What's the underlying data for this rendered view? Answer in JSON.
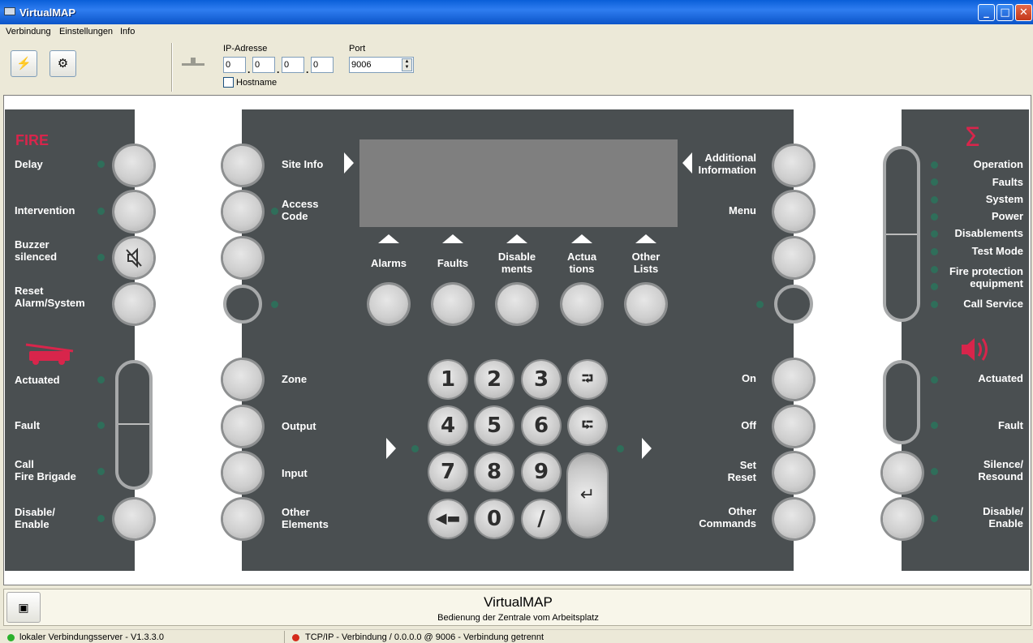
{
  "window": {
    "title": "VirtualMAP",
    "minimize": "_",
    "maximize": "□",
    "close": "✕"
  },
  "menu": [
    "Verbindung",
    "Einstellungen",
    "Info"
  ],
  "toolbar": {
    "connect_icon": "⚡",
    "settings_icon": "⚙",
    "ip_label": "IP-Adresse",
    "ip": [
      "0",
      "0",
      "0",
      "0"
    ],
    "ip_separator": ".",
    "port_label": "Port",
    "port": "9006",
    "hostname_label": "Hostname",
    "hostname_checked": false
  },
  "panel": {
    "left": {
      "fire_title": "FIRE",
      "buttons": [
        "Delay",
        "Intervention",
        "Buzzer\nsilenced",
        "Reset\nAlarm/System"
      ],
      "brigade_buttons": [
        "Actuated",
        "Fault",
        "Call\nFire Brigade",
        "Disable/\nEnable"
      ]
    },
    "center_left": [
      "Site Info",
      "Access\nCode",
      "Zone",
      "Output",
      "Input",
      "Other\nElements"
    ],
    "center_right": [
      "Additional\nInformation",
      "Menu",
      "On",
      "Off",
      "Set\nReset",
      "Other\nCommands"
    ],
    "softkeys": [
      "Alarms",
      "Faults",
      "Disable\nments",
      "Actua\ntions",
      "Other\nLists"
    ],
    "numpad": [
      "1",
      "2",
      "3",
      "4",
      "5",
      "6",
      "7",
      "8",
      "9",
      "◀▬",
      "0",
      "/"
    ],
    "numpad_nav": [
      "⮒",
      "⮓"
    ],
    "enter": "↵",
    "right": {
      "sigma": "Σ",
      "indicators": [
        "Operation",
        "Faults",
        "System",
        "Power",
        "Disablements",
        "Test Mode",
        "Fire protection\nequipment",
        "Call Service"
      ],
      "alarm_buttons": [
        "Actuated",
        "Fault",
        "Silence/\nResound",
        "Disable/\nEnable"
      ]
    },
    "colors": {
      "panel": "#4a4f51",
      "accent_red": "#d8254b",
      "led": "#2f6e5a"
    }
  },
  "footer": {
    "title": "VirtualMAP",
    "subtitle": "Bedienung der Zentrale vom Arbeitsplatz",
    "icon": "▣"
  },
  "status": {
    "server": "lokaler Verbindungsserver - V1.3.3.0",
    "connection": "TCP/IP - Verbindung / 0.0.0.0 @ 9006 - Verbindung getrennt",
    "server_color": "#2bb12b",
    "connection_color": "#d42a1a"
  }
}
